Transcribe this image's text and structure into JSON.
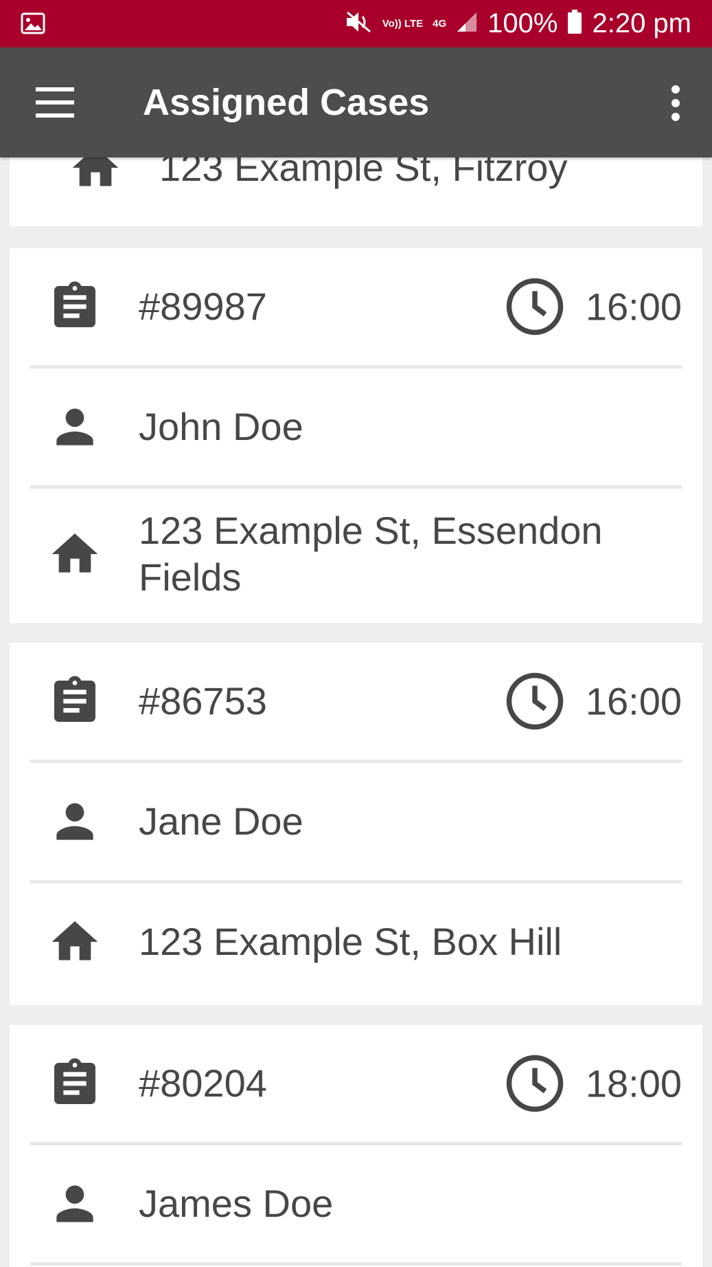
{
  "status_bar": {
    "volte": "Vo)) LTE",
    "network": "4G",
    "battery": "100%",
    "time": "2:20 pm"
  },
  "app_bar": {
    "title": "Assigned Cases",
    "menu_icon": "hamburger-menu-icon",
    "overflow_icon": "more-vert-icon"
  },
  "partial_card": {
    "address": "123 Example St, Fitzroy"
  },
  "cases": [
    {
      "case_number": "#89987",
      "time": "16:00",
      "name": "John Doe",
      "address": "123 Example St, Essendon Fields"
    },
    {
      "case_number": "#86753",
      "time": "16:00",
      "name": "Jane Doe",
      "address": "123 Example St, Box Hill"
    },
    {
      "case_number": "#80204",
      "time": "18:00",
      "name": "James Doe",
      "address": ""
    }
  ],
  "colors": {
    "status_bar": "#a8002b",
    "app_bar": "#4d4d4d",
    "icon": "#474747",
    "background": "#eeeeee"
  }
}
